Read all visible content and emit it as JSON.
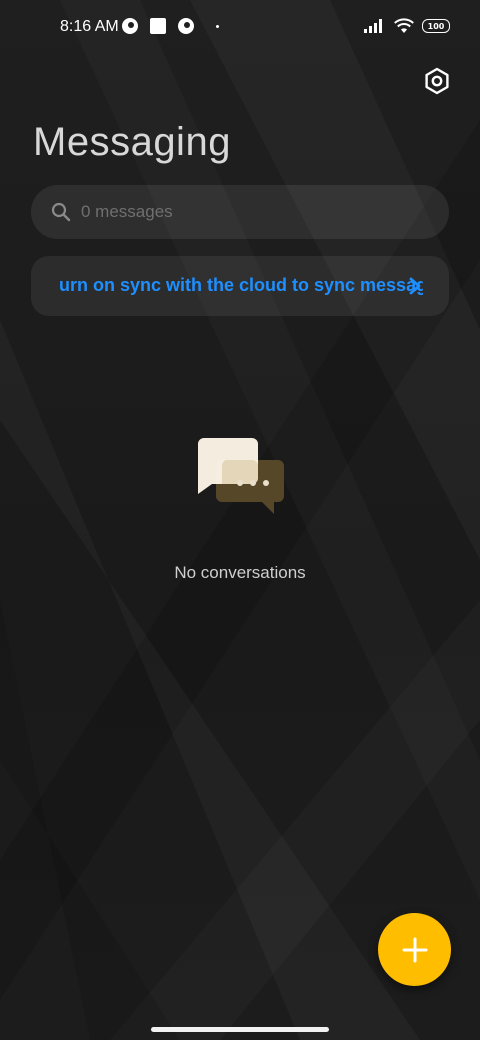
{
  "status_bar": {
    "time": "8:16 AM",
    "battery": "100"
  },
  "header": {
    "title": "Messaging",
    "settings_icon": "settings-hexagon-icon"
  },
  "search": {
    "placeholder": "0 messages",
    "value": "",
    "icon": "search-icon"
  },
  "sync_banner": {
    "text": "urn on sync with the cloud to sync messag",
    "color": "#1e8fff",
    "icon": "chevron-right-icon"
  },
  "empty_state": {
    "icon": "chat-bubbles-icon",
    "text": "No conversations"
  },
  "fab": {
    "icon": "plus-icon",
    "color": "#ffbd00"
  }
}
